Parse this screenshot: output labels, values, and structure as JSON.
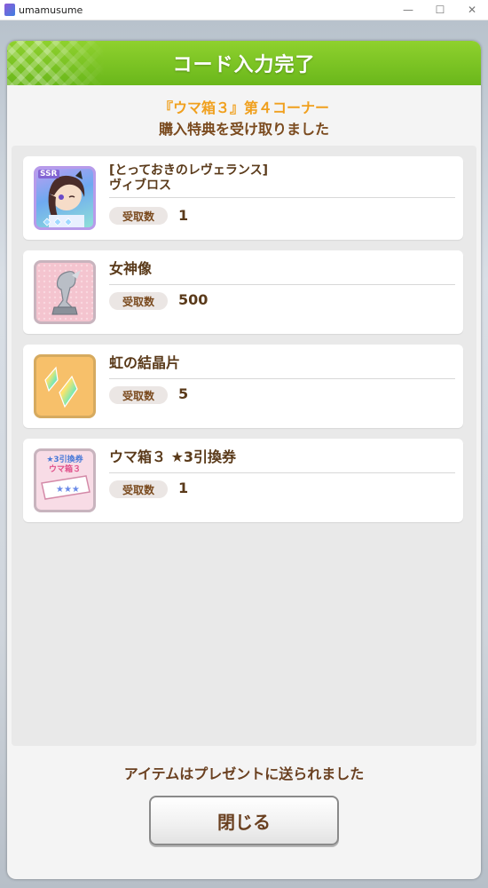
{
  "window": {
    "title": "umamusume",
    "controls": {
      "minimize": "—",
      "maximize": "☐",
      "close": "✕"
    }
  },
  "dialog": {
    "title": "コード入力完了",
    "subtitle": "『ウマ箱３』第４コーナー",
    "message": "購入特典を受け取りました",
    "items": [
      {
        "name_line1": "[とっておきのレヴェランス]",
        "name_line2": "ヴィブロス",
        "badge": "SSR",
        "count_label": "受取数",
        "count": "1"
      },
      {
        "name": "女神像",
        "count_label": "受取数",
        "count": "500"
      },
      {
        "name": "虹の結晶片",
        "count_label": "受取数",
        "count": "5"
      },
      {
        "name": "ウマ箱３ ★3引換券",
        "ticket_line1": "★3引換券",
        "ticket_line2": "ウマ箱３",
        "count_label": "受取数",
        "count": "1"
      }
    ],
    "footer": "アイテムはプレゼントに送られました",
    "close_button": "閉じる"
  },
  "colors": {
    "header": "#7cc524",
    "subtitle": "#f0a01e",
    "text_brown": "#5a3a1a"
  }
}
